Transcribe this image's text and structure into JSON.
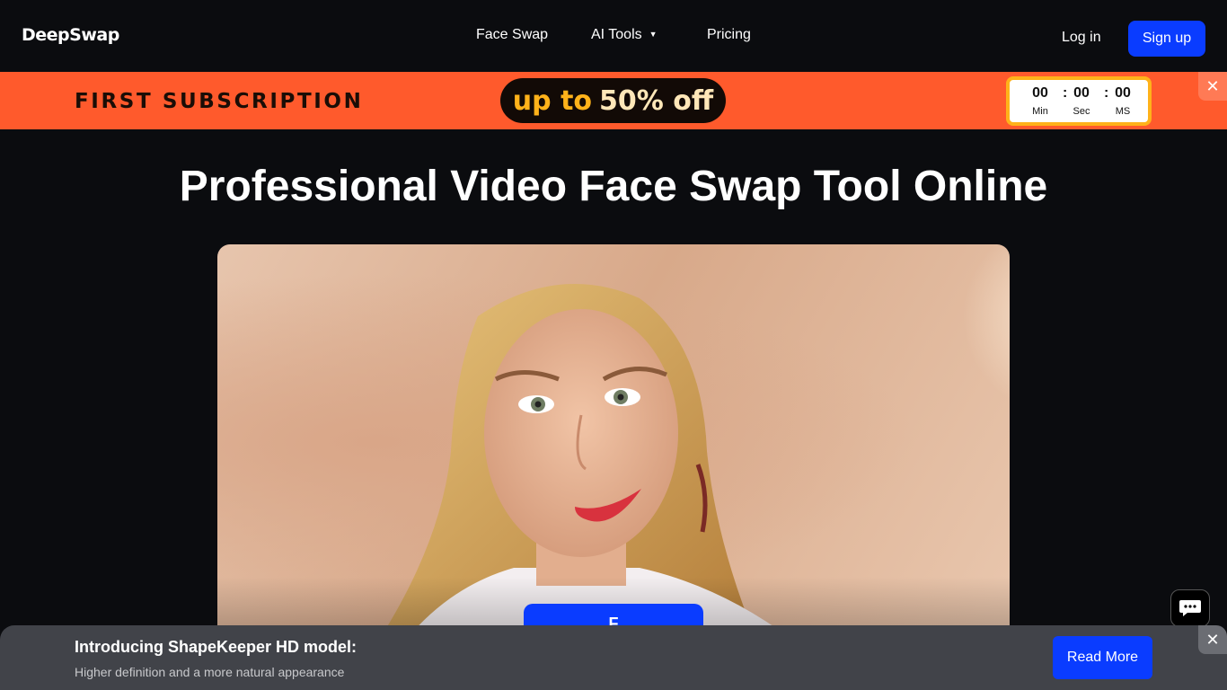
{
  "header": {
    "logo": "DeepSwap",
    "nav": {
      "face_swap": "Face Swap",
      "ai_tools": "AI Tools",
      "pricing": "Pricing"
    },
    "login": "Log in",
    "signup": "Sign up"
  },
  "promo": {
    "title": "FIRST SUBSCRIPTION",
    "offer_prefix": "up to",
    "offer_value": "50% off",
    "timer": [
      {
        "value": "00",
        "label": "Min"
      },
      {
        "value": "00",
        "label": "Sec"
      },
      {
        "value": "00",
        "label": "MS"
      }
    ],
    "close_glyph": "✕"
  },
  "hero": {
    "title": "Professional Video Face Swap Tool Online",
    "cta_partial": "F"
  },
  "bottom_bar": {
    "title": "Introducing ShapeKeeper HD model:",
    "subtitle": "Higher definition and a more natural appearance",
    "button": "Read More",
    "close_glyph": "✕"
  },
  "colors": {
    "accent_blue": "#0a3cff",
    "promo_orange": "#ff5a2c",
    "background": "#0b0c0f"
  },
  "icons": [
    "chevron-down-icon",
    "close-icon",
    "chat-icon"
  ]
}
